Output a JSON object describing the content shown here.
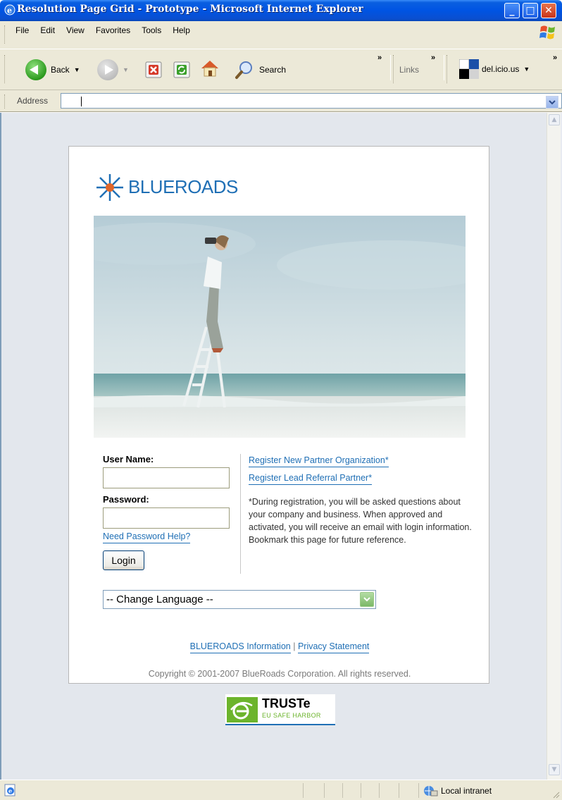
{
  "window": {
    "title": "Resolution Page Grid - Prototype - Microsoft Internet Explorer"
  },
  "menu": [
    "File",
    "Edit",
    "View",
    "Favorites",
    "Tools",
    "Help"
  ],
  "toolbar": {
    "back_label": "Back",
    "search_label": "Search",
    "links_label": "Links",
    "delicious_label": "del.icio.us",
    "chevron": "»"
  },
  "address": {
    "label": "Address",
    "value": ""
  },
  "page": {
    "brand": "BLUEROADS",
    "username_label": "User Name:",
    "password_label": "Password:",
    "password_help": "Need Password Help?",
    "login_label": "Login",
    "register_partner": "Register New Partner Organization*",
    "register_referral": "Register Lead Referral Partner*",
    "registration_note": "*During registration, you will be asked questions about your company and business. When approved and activated, you will receive an email with login information. Bookmark this page for future reference.",
    "language_select": "-- Change Language --",
    "footer_info": "BLUEROADS Information",
    "footer_sep": "|",
    "footer_privacy": "Privacy Statement",
    "copyright": "Copyright © 2001-2007 BlueRoads Corporation. All rights reserved.",
    "truste_name": "TRUSTe",
    "truste_sub": "EU SAFE HARBOR"
  },
  "status": {
    "zone": "Local intranet"
  },
  "colors": {
    "brand_blue": "#1f6fb5",
    "brand_orange": "#e0662a",
    "truste_green": "#6cb42c",
    "title_bar": "#0054e3",
    "chrome": "#ece9d8"
  }
}
